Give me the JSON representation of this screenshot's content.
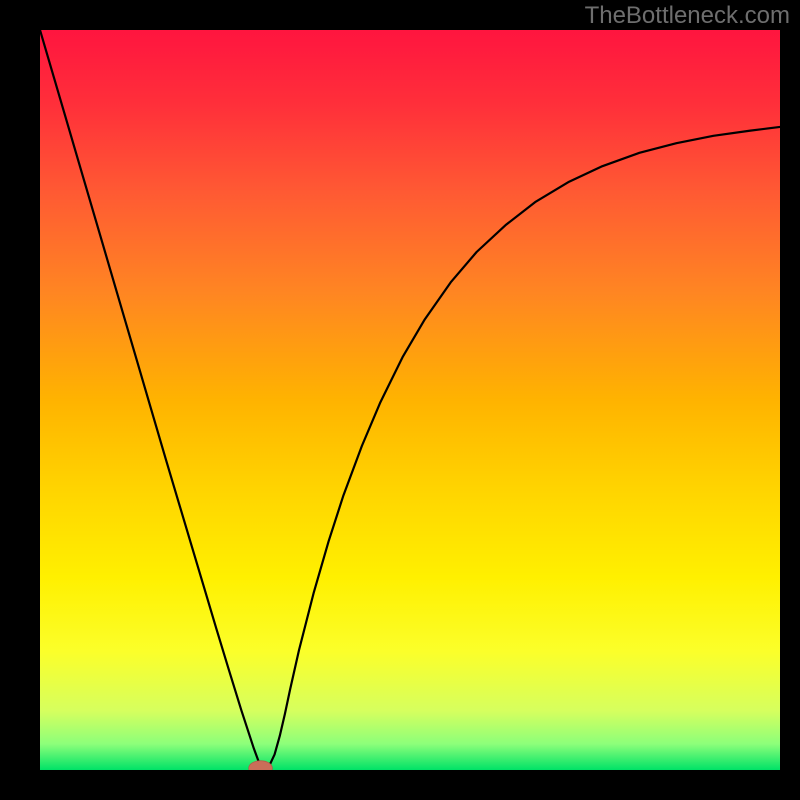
{
  "watermark": "TheBottleneck.com",
  "chart_data": {
    "type": "line",
    "title": "",
    "xlabel": "",
    "ylabel": "",
    "xlim": [
      0,
      100
    ],
    "ylim": [
      0,
      100
    ],
    "grid": false,
    "background_gradient": {
      "stops": [
        {
          "offset": 0.0,
          "color": "#ff153f"
        },
        {
          "offset": 0.1,
          "color": "#ff2f3a"
        },
        {
          "offset": 0.22,
          "color": "#ff5a33"
        },
        {
          "offset": 0.35,
          "color": "#ff8423"
        },
        {
          "offset": 0.5,
          "color": "#ffb300"
        },
        {
          "offset": 0.62,
          "color": "#ffd400"
        },
        {
          "offset": 0.74,
          "color": "#fff000"
        },
        {
          "offset": 0.84,
          "color": "#fbff2a"
        },
        {
          "offset": 0.92,
          "color": "#d6ff5e"
        },
        {
          "offset": 0.965,
          "color": "#8cff7a"
        },
        {
          "offset": 1.0,
          "color": "#00e267"
        }
      ]
    },
    "series": [
      {
        "name": "bottleneck-curve",
        "x": [
          0.0,
          1.7,
          3.4,
          5.1,
          6.8,
          8.5,
          10.2,
          11.9,
          13.6,
          15.3,
          17.0,
          18.7,
          20.4,
          22.1,
          23.8,
          25.5,
          27.2,
          28.9,
          29.6,
          30.3,
          31.0,
          31.7,
          32.4,
          33.1,
          33.8,
          35.0,
          37.0,
          39.0,
          41.0,
          43.5,
          46.0,
          49.0,
          52.0,
          55.5,
          59.0,
          63.0,
          67.0,
          71.5,
          76.0,
          81.0,
          86.0,
          91.0,
          96.0,
          100.0
        ],
        "y": [
          100.0,
          94.2,
          88.4,
          82.6,
          76.8,
          71.0,
          65.2,
          59.4,
          53.6,
          47.8,
          42.0,
          36.3,
          30.6,
          24.9,
          19.2,
          13.6,
          8.1,
          2.9,
          1.0,
          0.3,
          0.6,
          2.1,
          4.6,
          7.6,
          10.9,
          16.2,
          24.0,
          30.9,
          37.1,
          43.8,
          49.7,
          55.8,
          60.9,
          65.9,
          70.0,
          73.7,
          76.8,
          79.5,
          81.6,
          83.4,
          84.7,
          85.7,
          86.4,
          86.9
        ]
      }
    ],
    "marker": {
      "x": 29.8,
      "y": 0.25,
      "rx": 1.6,
      "ry": 1.0,
      "name": "optimal-point"
    }
  }
}
